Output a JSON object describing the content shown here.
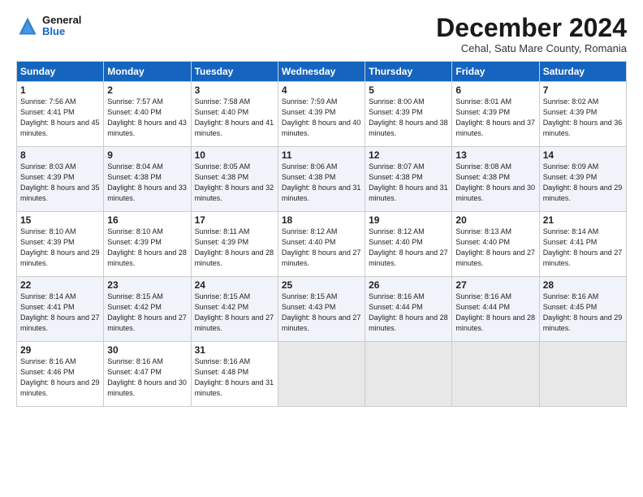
{
  "header": {
    "logo_general": "General",
    "logo_blue": "Blue",
    "title": "December 2024",
    "subtitle": "Cehal, Satu Mare County, Romania"
  },
  "days_of_week": [
    "Sunday",
    "Monday",
    "Tuesday",
    "Wednesday",
    "Thursday",
    "Friday",
    "Saturday"
  ],
  "weeks": [
    [
      {
        "day": 1,
        "sunrise": "7:56 AM",
        "sunset": "4:41 PM",
        "daylight": "8 hours and 45 minutes."
      },
      {
        "day": 2,
        "sunrise": "7:57 AM",
        "sunset": "4:40 PM",
        "daylight": "8 hours and 43 minutes."
      },
      {
        "day": 3,
        "sunrise": "7:58 AM",
        "sunset": "4:40 PM",
        "daylight": "8 hours and 41 minutes."
      },
      {
        "day": 4,
        "sunrise": "7:59 AM",
        "sunset": "4:39 PM",
        "daylight": "8 hours and 40 minutes."
      },
      {
        "day": 5,
        "sunrise": "8:00 AM",
        "sunset": "4:39 PM",
        "daylight": "8 hours and 38 minutes."
      },
      {
        "day": 6,
        "sunrise": "8:01 AM",
        "sunset": "4:39 PM",
        "daylight": "8 hours and 37 minutes."
      },
      {
        "day": 7,
        "sunrise": "8:02 AM",
        "sunset": "4:39 PM",
        "daylight": "8 hours and 36 minutes."
      }
    ],
    [
      {
        "day": 8,
        "sunrise": "8:03 AM",
        "sunset": "4:39 PM",
        "daylight": "8 hours and 35 minutes."
      },
      {
        "day": 9,
        "sunrise": "8:04 AM",
        "sunset": "4:38 PM",
        "daylight": "8 hours and 33 minutes."
      },
      {
        "day": 10,
        "sunrise": "8:05 AM",
        "sunset": "4:38 PM",
        "daylight": "8 hours and 32 minutes."
      },
      {
        "day": 11,
        "sunrise": "8:06 AM",
        "sunset": "4:38 PM",
        "daylight": "8 hours and 31 minutes."
      },
      {
        "day": 12,
        "sunrise": "8:07 AM",
        "sunset": "4:38 PM",
        "daylight": "8 hours and 31 minutes."
      },
      {
        "day": 13,
        "sunrise": "8:08 AM",
        "sunset": "4:38 PM",
        "daylight": "8 hours and 30 minutes."
      },
      {
        "day": 14,
        "sunrise": "8:09 AM",
        "sunset": "4:39 PM",
        "daylight": "8 hours and 29 minutes."
      }
    ],
    [
      {
        "day": 15,
        "sunrise": "8:10 AM",
        "sunset": "4:39 PM",
        "daylight": "8 hours and 29 minutes."
      },
      {
        "day": 16,
        "sunrise": "8:10 AM",
        "sunset": "4:39 PM",
        "daylight": "8 hours and 28 minutes."
      },
      {
        "day": 17,
        "sunrise": "8:11 AM",
        "sunset": "4:39 PM",
        "daylight": "8 hours and 28 minutes."
      },
      {
        "day": 18,
        "sunrise": "8:12 AM",
        "sunset": "4:40 PM",
        "daylight": "8 hours and 27 minutes."
      },
      {
        "day": 19,
        "sunrise": "8:12 AM",
        "sunset": "4:40 PM",
        "daylight": "8 hours and 27 minutes."
      },
      {
        "day": 20,
        "sunrise": "8:13 AM",
        "sunset": "4:40 PM",
        "daylight": "8 hours and 27 minutes."
      },
      {
        "day": 21,
        "sunrise": "8:14 AM",
        "sunset": "4:41 PM",
        "daylight": "8 hours and 27 minutes."
      }
    ],
    [
      {
        "day": 22,
        "sunrise": "8:14 AM",
        "sunset": "4:41 PM",
        "daylight": "8 hours and 27 minutes."
      },
      {
        "day": 23,
        "sunrise": "8:15 AM",
        "sunset": "4:42 PM",
        "daylight": "8 hours and 27 minutes."
      },
      {
        "day": 24,
        "sunrise": "8:15 AM",
        "sunset": "4:42 PM",
        "daylight": "8 hours and 27 minutes."
      },
      {
        "day": 25,
        "sunrise": "8:15 AM",
        "sunset": "4:43 PM",
        "daylight": "8 hours and 27 minutes."
      },
      {
        "day": 26,
        "sunrise": "8:16 AM",
        "sunset": "4:44 PM",
        "daylight": "8 hours and 28 minutes."
      },
      {
        "day": 27,
        "sunrise": "8:16 AM",
        "sunset": "4:44 PM",
        "daylight": "8 hours and 28 minutes."
      },
      {
        "day": 28,
        "sunrise": "8:16 AM",
        "sunset": "4:45 PM",
        "daylight": "8 hours and 29 minutes."
      }
    ],
    [
      {
        "day": 29,
        "sunrise": "8:16 AM",
        "sunset": "4:46 PM",
        "daylight": "8 hours and 29 minutes."
      },
      {
        "day": 30,
        "sunrise": "8:16 AM",
        "sunset": "4:47 PM",
        "daylight": "8 hours and 30 minutes."
      },
      {
        "day": 31,
        "sunrise": "8:16 AM",
        "sunset": "4:48 PM",
        "daylight": "8 hours and 31 minutes."
      },
      null,
      null,
      null,
      null
    ]
  ]
}
